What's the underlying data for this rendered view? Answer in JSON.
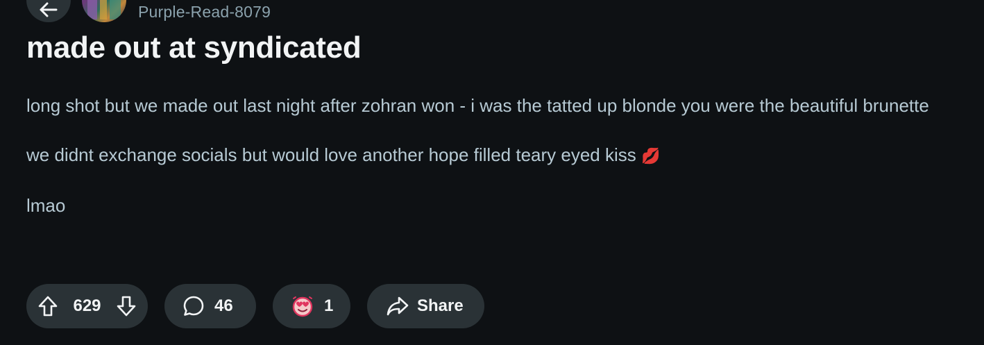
{
  "post": {
    "author": "Purple-Read-8079",
    "title": "made out at syndicated",
    "body": {
      "p1": "long shot but we made out last night after zohran won - i was the tatted up blonde you were the beautiful brunette",
      "p2": "we didnt exchange socials but would love another hope filled teary eyed kiss",
      "p2_emoji": "💋",
      "p3": "lmao"
    }
  },
  "actions": {
    "upvotes": "629",
    "comments": "46",
    "awards": "1",
    "share_label": "Share"
  },
  "icons": {
    "back": "arrow-left-icon",
    "upvote": "arrow-up-icon",
    "downvote": "arrow-down-icon",
    "comment": "speech-bubble-icon",
    "award": "heart-eyes-award-icon",
    "share": "share-arrow-icon"
  },
  "colors": {
    "background": "#0e1114",
    "pill": "#2a3236",
    "title": "#f2f4f5",
    "body_text": "#b7cad4",
    "username": "#8ba2ad",
    "award_red": "#e0355f"
  }
}
